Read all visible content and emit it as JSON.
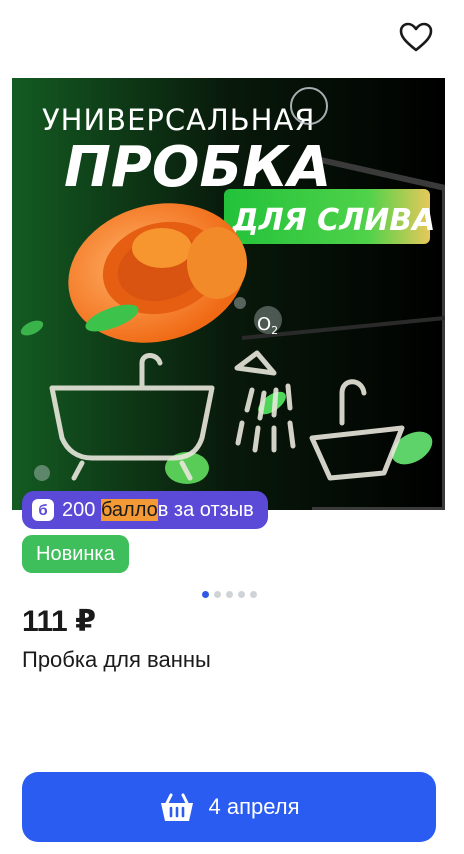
{
  "image": {
    "line1": "УНИВЕРСАЛЬНАЯ",
    "line2": "ПРОБКА",
    "line3": "ДЛЯ СЛИВА",
    "o2": "O",
    "o2sub": "2"
  },
  "badges": {
    "points_value": "200",
    "points_hl": "балло",
    "points_rest": "в за отзыв",
    "new": "Новинка"
  },
  "carousel": {
    "count": 5,
    "active": 1
  },
  "product": {
    "price": "111 ₽",
    "title": "Пробка для ванны"
  },
  "cta": {
    "label": "4 апреля"
  },
  "colors": {
    "accent": "#2b5cf2",
    "points": "#5b4ad8",
    "new": "#3fbf5c",
    "orange": "#f39a37"
  }
}
